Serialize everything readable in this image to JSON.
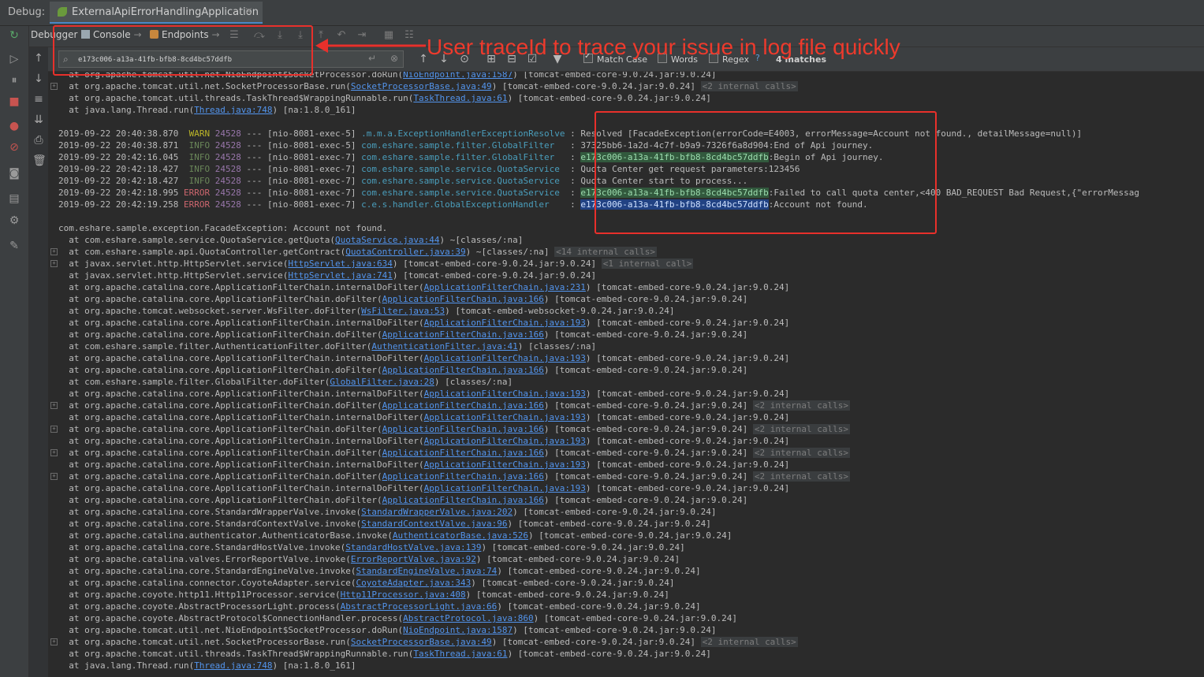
{
  "topbar": {
    "label": "Debug:",
    "tab_title": "ExternalApiErrorHandlingApplication",
    "tab_close": "×"
  },
  "tabs": [
    {
      "label": "Debugger"
    },
    {
      "label": "Console"
    },
    {
      "label": "Endpoints"
    }
  ],
  "search": {
    "value": "e173c006-a13a-41fb-bfb8-8cd4bc57ddfb",
    "options": {
      "match_case": "Match Case",
      "words": "Words",
      "regex": "Regex",
      "help": "?"
    },
    "match_case_checked": true,
    "words_checked": false,
    "regex_checked": false,
    "matches": "4 matches"
  },
  "annotation": {
    "text": "User traceId to trace your issue in log file quickly",
    "color": "#e8302b"
  },
  "log": {
    "pre": [
      "  at org.apache.tomcat.util.net.NioEndpoint$SocketProcessor.doRun(NioEndpoint.java:1587) [tomcat-embed-core-9.0.24.jar:9.0.24]",
      "  at org.apache.tomcat.util.net.SocketProcessorBase.run(SocketProcessorBase.java:49) [tomcat-embed-core-9.0.24.jar:9.0.24] <2 internal calls>",
      "  at org.apache.tomcat.util.threads.TaskThread$WrappingRunnable.run(TaskThread.java:61) [tomcat-embed-core-9.0.24.jar:9.0.24]",
      "  at java.lang.Thread.run(Thread.java:748) [na:1.8.0_161]"
    ],
    "entries": [
      {
        "ts": "2019-09-22 20:40:38.870",
        "level": "WARN",
        "pid": "24528",
        "sep": "---",
        "thread": "[nio-8081-exec-5]",
        "logger": ".m.m.a.ExceptionHandlerExceptionResolver",
        "colon": ":",
        "trace": "",
        "msg": "Resolved [FacadeException(errorCode=E4003, errorMessage=Account not found., detailMessage=null)]"
      },
      {
        "ts": "2019-09-22 20:40:38.871",
        "level": "INFO",
        "pid": "24528",
        "sep": "---",
        "thread": "[nio-8081-exec-5]",
        "logger": "com.eshare.sample.filter.GlobalFilter",
        "colon": ":",
        "trace": "",
        "msg": "37325bb6-1a2d-4c7f-b9a9-7326f6a8d904:End of Api journey."
      },
      {
        "ts": "2019-09-22 20:42:16.045",
        "level": "INFO",
        "pid": "24528",
        "sep": "---",
        "thread": "[nio-8081-exec-7]",
        "logger": "com.eshare.sample.filter.GlobalFilter",
        "colon": ":",
        "trace": "e173c006-a13a-41fb-bfb8-8cd4bc57ddfb",
        "msg": ":Begin of Api journey."
      },
      {
        "ts": "2019-09-22 20:42:18.427",
        "level": "INFO",
        "pid": "24528",
        "sep": "---",
        "thread": "[nio-8081-exec-7]",
        "logger": "com.eshare.sample.service.QuotaService",
        "colon": ":",
        "trace": "",
        "msg": "Quota Center get request parameters:123456"
      },
      {
        "ts": "2019-09-22 20:42:18.427",
        "level": "INFO",
        "pid": "24528",
        "sep": "---",
        "thread": "[nio-8081-exec-7]",
        "logger": "com.eshare.sample.service.QuotaService",
        "colon": ":",
        "trace": "",
        "msg": "Quota Center start to process..."
      },
      {
        "ts": "2019-09-22 20:42:18.995",
        "level": "ERROR",
        "pid": "24528",
        "sep": "---",
        "thread": "[nio-8081-exec-7]",
        "logger": "com.eshare.sample.service.QuotaService",
        "colon": ":",
        "trace": "e173c006-a13a-41fb-bfb8-8cd4bc57ddfb",
        "msg": ":Failed to call quota center,<400 BAD_REQUEST Bad Request,{\"errorMessag"
      },
      {
        "ts": "2019-09-22 20:42:19.258",
        "level": "ERROR",
        "pid": "24528",
        "sep": "---",
        "thread": "[nio-8081-exec-7]",
        "logger": "c.e.s.handler.GlobalExceptionHandler",
        "colon": ":",
        "trace": "e173c006-a13a-41fb-bfb8-8cd4bc57ddfb",
        "msg": ":Account not found."
      }
    ],
    "exception": "com.eshare.sample.exception.FacadeException: Account not found.",
    "stack": [
      "  at com.eshare.sample.service.QuotaService.getQuota(QuotaService.java:44) ~[classes/:na]",
      "  at com.eshare.sample.api.QuotaController.getContract(QuotaController.java:39) ~[classes/:na] <14 internal calls>",
      "  at javax.servlet.http.HttpServlet.service(HttpServlet.java:634) [tomcat-embed-core-9.0.24.jar:9.0.24] <1 internal call>",
      "  at javax.servlet.http.HttpServlet.service(HttpServlet.java:741) [tomcat-embed-core-9.0.24.jar:9.0.24]",
      "  at org.apache.catalina.core.ApplicationFilterChain.internalDoFilter(ApplicationFilterChain.java:231) [tomcat-embed-core-9.0.24.jar:9.0.24]",
      "  at org.apache.catalina.core.ApplicationFilterChain.doFilter(ApplicationFilterChain.java:166) [tomcat-embed-core-9.0.24.jar:9.0.24]",
      "  at org.apache.tomcat.websocket.server.WsFilter.doFilter(WsFilter.java:53) [tomcat-embed-websocket-9.0.24.jar:9.0.24]",
      "  at org.apache.catalina.core.ApplicationFilterChain.internalDoFilter(ApplicationFilterChain.java:193) [tomcat-embed-core-9.0.24.jar:9.0.24]",
      "  at org.apache.catalina.core.ApplicationFilterChain.doFilter(ApplicationFilterChain.java:166) [tomcat-embed-core-9.0.24.jar:9.0.24]",
      "  at com.eshare.sample.filter.AuthenticationFilter.doFilter(AuthenticationFilter.java:41) [classes/:na]",
      "  at org.apache.catalina.core.ApplicationFilterChain.internalDoFilter(ApplicationFilterChain.java:193) [tomcat-embed-core-9.0.24.jar:9.0.24]",
      "  at org.apache.catalina.core.ApplicationFilterChain.doFilter(ApplicationFilterChain.java:166) [tomcat-embed-core-9.0.24.jar:9.0.24]",
      "  at com.eshare.sample.filter.GlobalFilter.doFilter(GlobalFilter.java:28) [classes/:na]",
      "  at org.apache.catalina.core.ApplicationFilterChain.internalDoFilter(ApplicationFilterChain.java:193) [tomcat-embed-core-9.0.24.jar:9.0.24]",
      "  at org.apache.catalina.core.ApplicationFilterChain.doFilter(ApplicationFilterChain.java:166) [tomcat-embed-core-9.0.24.jar:9.0.24] <2 internal calls>",
      "  at org.apache.catalina.core.ApplicationFilterChain.internalDoFilter(ApplicationFilterChain.java:193) [tomcat-embed-core-9.0.24.jar:9.0.24]",
      "  at org.apache.catalina.core.ApplicationFilterChain.doFilter(ApplicationFilterChain.java:166) [tomcat-embed-core-9.0.24.jar:9.0.24] <2 internal calls>",
      "  at org.apache.catalina.core.ApplicationFilterChain.internalDoFilter(ApplicationFilterChain.java:193) [tomcat-embed-core-9.0.24.jar:9.0.24]",
      "  at org.apache.catalina.core.ApplicationFilterChain.doFilter(ApplicationFilterChain.java:166) [tomcat-embed-core-9.0.24.jar:9.0.24] <2 internal calls>",
      "  at org.apache.catalina.core.ApplicationFilterChain.internalDoFilter(ApplicationFilterChain.java:193) [tomcat-embed-core-9.0.24.jar:9.0.24]",
      "  at org.apache.catalina.core.ApplicationFilterChain.doFilter(ApplicationFilterChain.java:166) [tomcat-embed-core-9.0.24.jar:9.0.24] <2 internal calls>",
      "  at org.apache.catalina.core.ApplicationFilterChain.internalDoFilter(ApplicationFilterChain.java:193) [tomcat-embed-core-9.0.24.jar:9.0.24]",
      "  at org.apache.catalina.core.ApplicationFilterChain.doFilter(ApplicationFilterChain.java:166) [tomcat-embed-core-9.0.24.jar:9.0.24]",
      "  at org.apache.catalina.core.StandardWrapperValve.invoke(StandardWrapperValve.java:202) [tomcat-embed-core-9.0.24.jar:9.0.24]",
      "  at org.apache.catalina.core.StandardContextValve.invoke(StandardContextValve.java:96) [tomcat-embed-core-9.0.24.jar:9.0.24]",
      "  at org.apache.catalina.authenticator.AuthenticatorBase.invoke(AuthenticatorBase.java:526) [tomcat-embed-core-9.0.24.jar:9.0.24]",
      "  at org.apache.catalina.core.StandardHostValve.invoke(StandardHostValve.java:139) [tomcat-embed-core-9.0.24.jar:9.0.24]",
      "  at org.apache.catalina.valves.ErrorReportValve.invoke(ErrorReportValve.java:92) [tomcat-embed-core-9.0.24.jar:9.0.24]",
      "  at org.apache.catalina.core.StandardEngineValve.invoke(StandardEngineValve.java:74) [tomcat-embed-core-9.0.24.jar:9.0.24]",
      "  at org.apache.catalina.connector.CoyoteAdapter.service(CoyoteAdapter.java:343) [tomcat-embed-core-9.0.24.jar:9.0.24]",
      "  at org.apache.coyote.http11.Http11Processor.service(Http11Processor.java:408) [tomcat-embed-core-9.0.24.jar:9.0.24]",
      "  at org.apache.coyote.AbstractProcessorLight.process(AbstractProcessorLight.java:66) [tomcat-embed-core-9.0.24.jar:9.0.24]",
      "  at org.apache.coyote.AbstractProtocol$ConnectionHandler.process(AbstractProtocol.java:860) [tomcat-embed-core-9.0.24.jar:9.0.24]",
      "  at org.apache.tomcat.util.net.NioEndpoint$SocketProcessor.doRun(NioEndpoint.java:1587) [tomcat-embed-core-9.0.24.jar:9.0.24]",
      "  at org.apache.tomcat.util.net.SocketProcessorBase.run(SocketProcessorBase.java:49) [tomcat-embed-core-9.0.24.jar:9.0.24] <2 internal calls>",
      "  at org.apache.tomcat.util.threads.TaskThread$WrappingRunnable.run(TaskThread.java:61) [tomcat-embed-core-9.0.24.jar:9.0.24]",
      "  at java.lang.Thread.run(Thread.java:748) [na:1.8.0_161]"
    ]
  }
}
